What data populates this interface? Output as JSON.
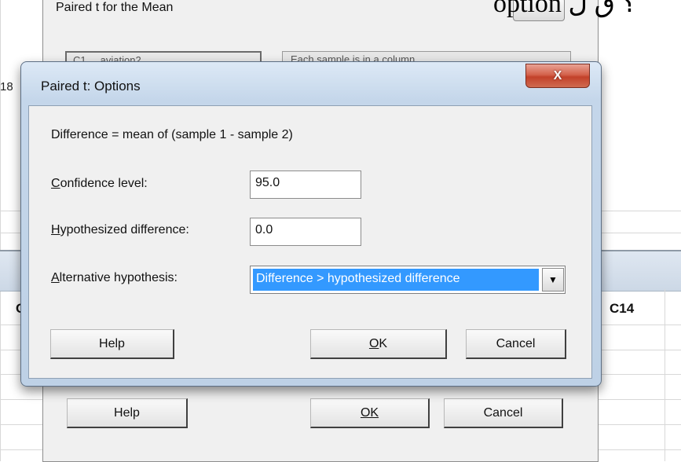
{
  "overlay_text": "option ؟ ق ل",
  "worksheet": {
    "row_label": "18",
    "col_label_left": "C",
    "col_label_right": "C14"
  },
  "background_dialog": {
    "title": "Paired t for the Mean",
    "listbox_text": "C1 ... aviation2",
    "select_text": "Each sample is in a column",
    "buttons": {
      "help": "Help",
      "ok": "OK",
      "cancel": "Cancel"
    }
  },
  "options_dialog": {
    "title": "Paired t: Options",
    "close_glyph": "X",
    "difference_text": "Difference = mean of (sample 1 - sample 2)",
    "confidence": {
      "label_mnemonic": "C",
      "label_rest": "onfidence level:",
      "value": "95.0"
    },
    "hypothesized": {
      "label_mnemonic": "H",
      "label_rest": "ypothesized difference:",
      "value": "0.0"
    },
    "alternative": {
      "label_mnemonic": "A",
      "label_rest": "lternative hypothesis:",
      "selected": "Difference > hypothesized difference"
    },
    "buttons": {
      "help": "Help",
      "ok_mnemonic": "O",
      "ok_rest": "K",
      "cancel": "Cancel"
    }
  },
  "colors": {
    "selection": "#3399ff",
    "close_button": "#c2412a",
    "title_bar": "#c4d6ea"
  }
}
